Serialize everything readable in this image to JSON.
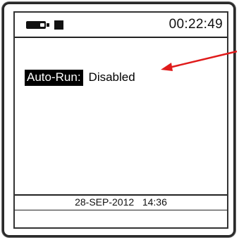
{
  "status_bar": {
    "time": "00:22:49",
    "icons": [
      "battery-icon",
      "stop-icon"
    ]
  },
  "setting": {
    "label": "Auto-Run:",
    "value": "Disabled"
  },
  "footer": {
    "datetime": "28-SEP-2012   14:36"
  },
  "colors": {
    "annotation_arrow": "#e01b1b",
    "label_bg": "#000000",
    "label_fg": "#ffffff"
  }
}
